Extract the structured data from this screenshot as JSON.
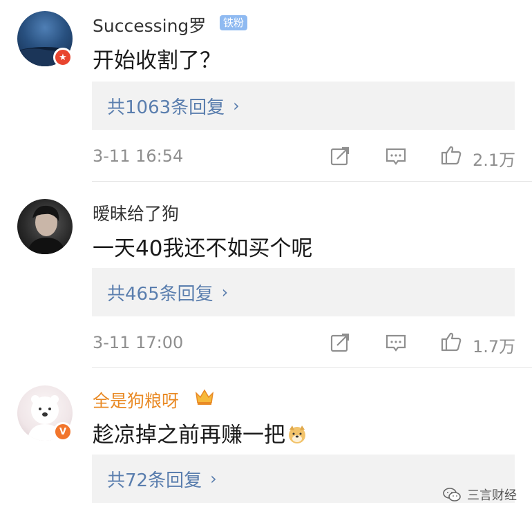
{
  "comments": [
    {
      "username": "Successing罗",
      "fan_badge": "铁粉",
      "text": "开始收割了？",
      "replies_label": "共1063条回复",
      "timestamp": "3-11 16:54",
      "likes": "2.1万"
    },
    {
      "username": "暧昧给了狗",
      "text": "一天40我还不如买个呢",
      "replies_label": "共465条回复",
      "timestamp": "3-11 17:00",
      "likes": "1.7万"
    },
    {
      "username": "全是狗粮呀",
      "text": "趁凉掉之前再赚一把",
      "replies_label": "共72条回复",
      "badge": "V"
    }
  ],
  "icons": {
    "chevron": "›",
    "repost": "repost-icon",
    "comment": "comment-icon",
    "like": "thumbs-up-icon"
  },
  "watermark": "三言财经",
  "colors": {
    "link_blue": "#5a7eae",
    "vip_gold": "#e98a25",
    "fan_badge_bg": "#8fbaf1"
  }
}
